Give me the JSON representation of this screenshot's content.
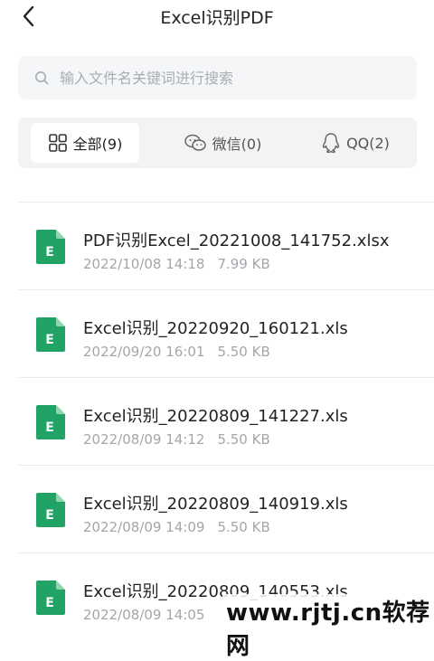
{
  "header": {
    "title": "Excel识别PDF"
  },
  "search": {
    "placeholder": "输入文件名关键词进行搜索"
  },
  "tabs": [
    {
      "label": "全部(9)",
      "icon": "grid-icon",
      "active": true
    },
    {
      "label": "微信(0)",
      "icon": "wechat-icon",
      "active": false
    },
    {
      "label": "QQ(2)",
      "icon": "qq-icon",
      "active": false
    }
  ],
  "files": [
    {
      "name": "PDF识别Excel_20221008_141752.xlsx",
      "date": "2022/10/08 14:18",
      "size": "7.99 KB",
      "icon_letter": "E"
    },
    {
      "name": "Excel识别_20220920_160121.xls",
      "date": "2022/09/20 16:01",
      "size": "5.50 KB",
      "icon_letter": "E"
    },
    {
      "name": "Excel识别_20220809_141227.xls",
      "date": "2022/08/09 14:12",
      "size": "5.50 KB",
      "icon_letter": "E"
    },
    {
      "name": "Excel识别_20220809_140919.xls",
      "date": "2022/08/09 14:09",
      "size": "5.50 KB",
      "icon_letter": "E"
    },
    {
      "name": "Excel识别_20220809_140553.xls",
      "date": "2022/08/09 14:05",
      "size": "",
      "icon_letter": "E"
    }
  ],
  "watermark": {
    "text": "www.rjtj.cn软荐网"
  },
  "colors": {
    "excel_green": "#21a366",
    "active_tab_bg": "#ffffff",
    "tabs_bg": "#f2f3f5"
  }
}
